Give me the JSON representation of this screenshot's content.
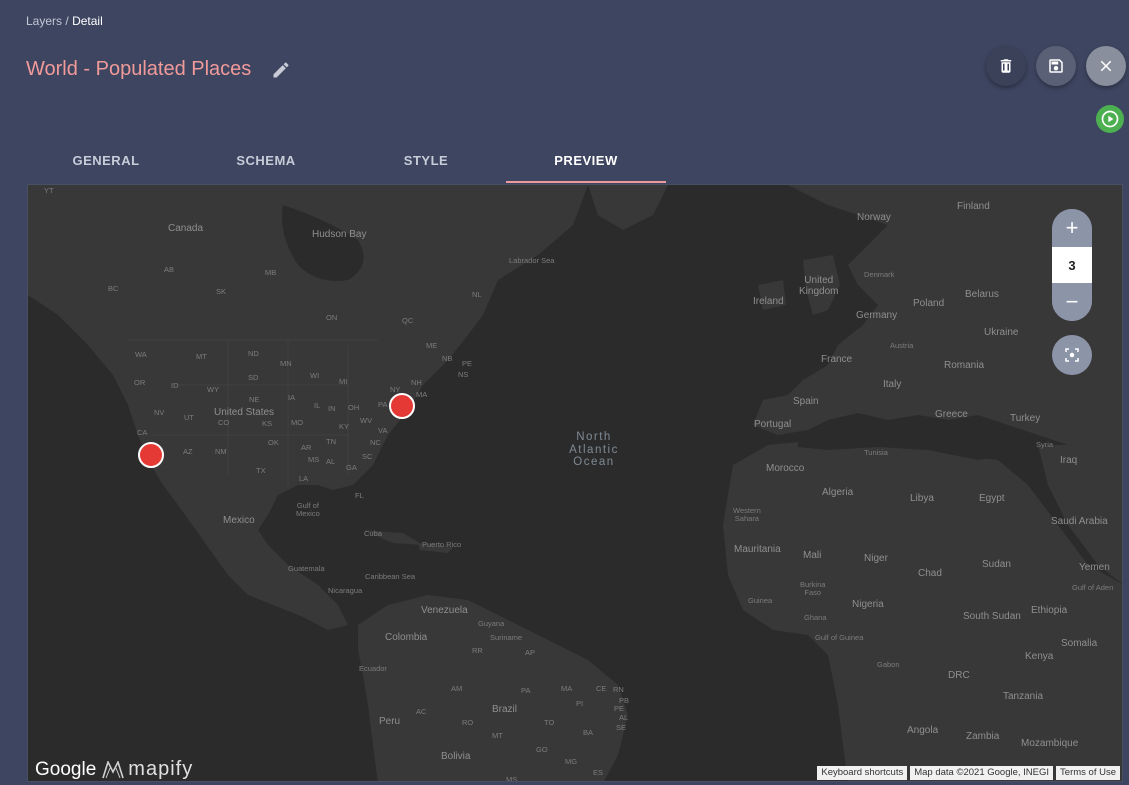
{
  "breadcrumb": {
    "parent": "Layers",
    "separator": "/",
    "current": "Detail"
  },
  "page": {
    "title": "World - Populated Places"
  },
  "tabs": [
    {
      "label": "GENERAL",
      "active": false
    },
    {
      "label": "SCHEMA",
      "active": false
    },
    {
      "label": "STYLE",
      "active": false
    },
    {
      "label": "PREVIEW",
      "active": true
    }
  ],
  "map": {
    "zoom_level": "3",
    "zoom_in": "+",
    "zoom_out": "−",
    "branding": {
      "google": "Google",
      "mapify": "mapify"
    },
    "attribution": {
      "shortcuts": "Keyboard shortcuts",
      "data": "Map data ©2021 Google, INEGI",
      "terms": "Terms of Use"
    },
    "markers": [
      "New York",
      "Los Angeles"
    ],
    "labels": {
      "canada": "Canada",
      "hudson": "Hudson Bay",
      "labrador": "Labrador Sea",
      "yt": "YT",
      "bc": "BC",
      "ab": "AB",
      "sk": "SK",
      "mb": "MB",
      "on": "ON",
      "qc": "QC",
      "nl": "NL",
      "nb": "NB",
      "pe": "PE",
      "ns": "NS",
      "me": "ME",
      "nh": "NH",
      "ny": "NY",
      "ma": "MA",
      "pa": "PA",
      "wa": "WA",
      "mt": "MT",
      "nd": "ND",
      "mn": "MN",
      "or": "OR",
      "id": "ID",
      "wy": "WY",
      "sd": "SD",
      "wi": "WI",
      "mi": "MI",
      "ia": "IA",
      "ne": "NE",
      "oh": "OH",
      "il": "IL",
      "in": "IN",
      "nv": "NV",
      "ut": "UT",
      "co": "CO",
      "ks": "KS",
      "mo": "MO",
      "ky": "KY",
      "wv": "WV",
      "va": "VA",
      "ca": "CA",
      "az": "AZ",
      "nm": "NM",
      "ok": "OK",
      "tn": "TN",
      "nc": "NC",
      "ar": "AR",
      "sc": "SC",
      "ms": "MS",
      "al": "AL",
      "ga": "GA",
      "tx": "TX",
      "la": "LA",
      "fl": "FL",
      "us": "United States",
      "gulf": "Gulf of\nMexico",
      "mexico": "Mexico",
      "cuba": "Cuba",
      "pr": "Puerto Rico",
      "guatemala": "Guatemala",
      "caribbean": "Caribbean Sea",
      "nicaragua": "Nicaragua",
      "venezuela": "Venezuela",
      "guyana": "Guyana",
      "suriname": "Suriname",
      "colombia": "Colombia",
      "rr": "RR",
      "ap": "AP",
      "ecuador": "Ecuador",
      "am": "AM",
      "pa2": "PA",
      "ma2": "MA",
      "ce": "CE",
      "rn": "RN",
      "pb": "PB",
      "pi": "PI",
      "pe2": "PE",
      "al2": "AL",
      "brazil": "Brazil",
      "ac": "AC",
      "ro": "RO",
      "to": "TO",
      "ba": "BA",
      "se": "SE",
      "peru": "Peru",
      "mt2": "MT",
      "go": "GO",
      "bolivia": "Bolivia",
      "mg": "MG",
      "es": "ES",
      "ms2": "MS",
      "ocean": "North\nAtlantic\nOcean",
      "norway": "Norway",
      "finland": "Finland",
      "denmark": "Denmark",
      "uk": "United\nKingdom",
      "ireland": "Ireland",
      "poland": "Poland",
      "belarus": "Belarus",
      "germany": "Germany",
      "ukraine": "Ukraine",
      "austria": "Austria",
      "france": "France",
      "romania": "Romania",
      "italy": "Italy",
      "spain": "Spain",
      "portugal": "Portugal",
      "greece": "Greece",
      "turkey": "Turkey",
      "syria": "Syria",
      "iraq": "Iraq",
      "tunisia": "Tunisia",
      "morocco": "Morocco",
      "algeria": "Algeria",
      "libya": "Libya",
      "egypt": "Egypt",
      "wsahara": "Western\nSahara",
      "saudi": "Saudi Arabia",
      "mauritania": "Mauritania",
      "mali": "Mali",
      "niger": "Niger",
      "chad": "Chad",
      "sudan": "Sudan",
      "yemen": "Yemen",
      "gulfaden": "Gulf of Aden",
      "burkina": "Burkina\nFaso",
      "guinea": "Guinea",
      "nigeria": "Nigeria",
      "ghana": "Ghana",
      "ssudan": "South Sudan",
      "ethiopia": "Ethiopia",
      "gulfguinea": "Gulf of Guinea",
      "somalia": "Somalia",
      "gabon": "Gabon",
      "kenya": "Kenya",
      "drc": "DRC",
      "tanzania": "Tanzania",
      "angola": "Angola",
      "zambia": "Zambia",
      "mozambique": "Mozambique"
    }
  }
}
